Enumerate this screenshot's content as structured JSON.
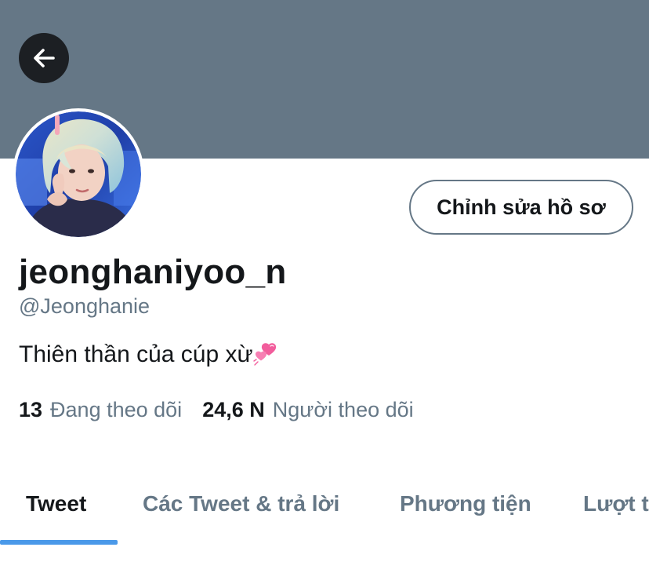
{
  "header": {
    "back_icon": "arrow-left-icon"
  },
  "profile": {
    "avatar_alt": "profile photo",
    "edit_button_label": "Chỉnh sửa hồ sơ",
    "display_name": "jeonghaniyoo_n",
    "handle": "@Jeonghanie",
    "bio": "Thiên thần của cúp xừ",
    "bio_emoji": "two-hearts-emoji"
  },
  "stats": {
    "following_count": "13",
    "following_label": "Đang theo dõi",
    "followers_count": "24,6 N",
    "followers_label": "Người theo dõi"
  },
  "tabs": [
    {
      "label": "Tweet",
      "active": true
    },
    {
      "label": "Các Tweet & trả lời",
      "active": false
    },
    {
      "label": "Phương tiện",
      "active": false
    },
    {
      "label": "Lượt thích",
      "active": false
    }
  ],
  "colors": {
    "banner": "#657786",
    "accent": "#4a99e9",
    "secondary_text": "#657786",
    "primary_text": "#14171a"
  }
}
